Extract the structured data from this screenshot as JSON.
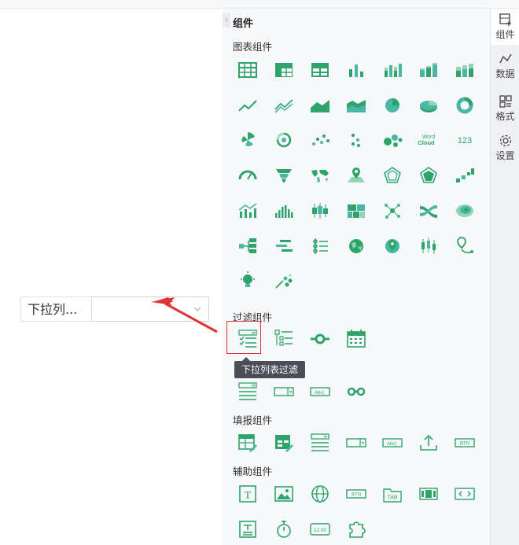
{
  "canvas": {
    "filter_widget": {
      "label": "下拉列...",
      "value": ""
    }
  },
  "panel": {
    "title": "组件",
    "sections": {
      "chart": "图表组件",
      "filter": "过滤组件",
      "fill": "填报组件",
      "aux": "辅助组件"
    },
    "tooltip": "下拉列表过滤",
    "text_icons": {
      "wordcloud1": "Word",
      "wordcloud2": "Cloud",
      "number": "123",
      "abc": "Abc|",
      "btn": "BTN",
      "tab": "TAB",
      "clock": "12:00",
      "text": "T"
    }
  },
  "rightbar": {
    "items": [
      {
        "label": "组件",
        "icon": "component-icon",
        "active": true
      },
      {
        "label": "数据",
        "icon": "data-icon"
      },
      {
        "label": "格式",
        "icon": "format-icon"
      },
      {
        "label": "设置",
        "icon": "settings-icon"
      }
    ]
  },
  "colors": {
    "green": "#2ea36a",
    "teal": "#49b7a3",
    "light_green": "#8ed6b4",
    "accent_red": "#e03333",
    "panel_bg": "#f7f8fa"
  }
}
